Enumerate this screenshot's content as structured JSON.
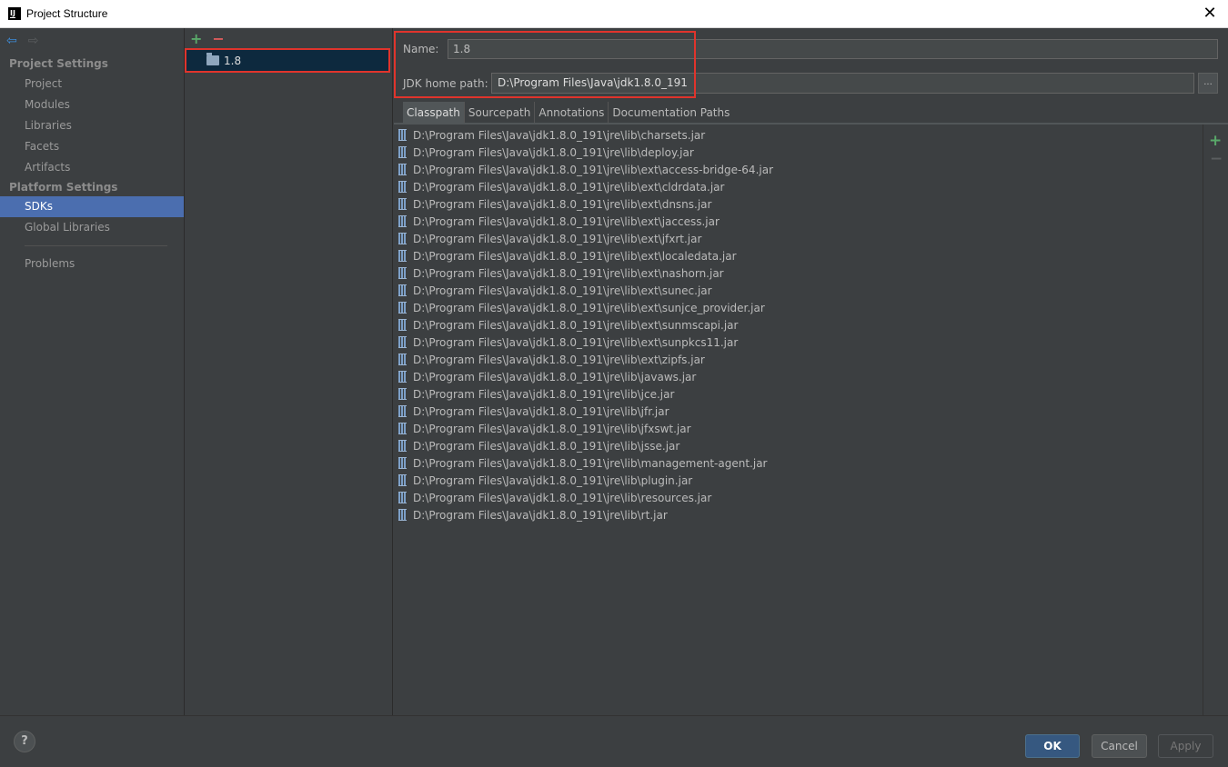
{
  "window": {
    "title": "Project Structure",
    "close_glyph": "✕",
    "logo_text": "IJ"
  },
  "nav": {
    "back_glyph": "⇦",
    "forward_glyph": "⇨",
    "project_settings_title": "Project Settings",
    "project_settings_items": [
      "Project",
      "Modules",
      "Libraries",
      "Facets",
      "Artifacts"
    ],
    "platform_settings_title": "Platform Settings",
    "platform_settings_items": [
      "SDKs",
      "Global Libraries"
    ],
    "active_item": "SDKs",
    "problems": "Problems"
  },
  "sdk_list": {
    "add_glyph": "+",
    "remove_glyph": "−",
    "items": [
      "1.8"
    ],
    "selected": "1.8"
  },
  "detail": {
    "name_label": "Name:",
    "name_value": "1.8",
    "jdk_label": "JDK home path:",
    "jdk_value": "D:\\Program Files\\Java\\jdk1.8.0_191",
    "browse_label": "...",
    "tabs": [
      "Classpath",
      "Sourcepath",
      "Annotations",
      "Documentation Paths"
    ],
    "active_tab": "Classpath",
    "add_glyph": "+",
    "remove_glyph": "−",
    "classpath": [
      "D:\\Program Files\\Java\\jdk1.8.0_191\\jre\\lib\\charsets.jar",
      "D:\\Program Files\\Java\\jdk1.8.0_191\\jre\\lib\\deploy.jar",
      "D:\\Program Files\\Java\\jdk1.8.0_191\\jre\\lib\\ext\\access-bridge-64.jar",
      "D:\\Program Files\\Java\\jdk1.8.0_191\\jre\\lib\\ext\\cldrdata.jar",
      "D:\\Program Files\\Java\\jdk1.8.0_191\\jre\\lib\\ext\\dnsns.jar",
      "D:\\Program Files\\Java\\jdk1.8.0_191\\jre\\lib\\ext\\jaccess.jar",
      "D:\\Program Files\\Java\\jdk1.8.0_191\\jre\\lib\\ext\\jfxrt.jar",
      "D:\\Program Files\\Java\\jdk1.8.0_191\\jre\\lib\\ext\\localedata.jar",
      "D:\\Program Files\\Java\\jdk1.8.0_191\\jre\\lib\\ext\\nashorn.jar",
      "D:\\Program Files\\Java\\jdk1.8.0_191\\jre\\lib\\ext\\sunec.jar",
      "D:\\Program Files\\Java\\jdk1.8.0_191\\jre\\lib\\ext\\sunjce_provider.jar",
      "D:\\Program Files\\Java\\jdk1.8.0_191\\jre\\lib\\ext\\sunmscapi.jar",
      "D:\\Program Files\\Java\\jdk1.8.0_191\\jre\\lib\\ext\\sunpkcs11.jar",
      "D:\\Program Files\\Java\\jdk1.8.0_191\\jre\\lib\\ext\\zipfs.jar",
      "D:\\Program Files\\Java\\jdk1.8.0_191\\jre\\lib\\javaws.jar",
      "D:\\Program Files\\Java\\jdk1.8.0_191\\jre\\lib\\jce.jar",
      "D:\\Program Files\\Java\\jdk1.8.0_191\\jre\\lib\\jfr.jar",
      "D:\\Program Files\\Java\\jdk1.8.0_191\\jre\\lib\\jfxswt.jar",
      "D:\\Program Files\\Java\\jdk1.8.0_191\\jre\\lib\\jsse.jar",
      "D:\\Program Files\\Java\\jdk1.8.0_191\\jre\\lib\\management-agent.jar",
      "D:\\Program Files\\Java\\jdk1.8.0_191\\jre\\lib\\plugin.jar",
      "D:\\Program Files\\Java\\jdk1.8.0_191\\jre\\lib\\resources.jar",
      "D:\\Program Files\\Java\\jdk1.8.0_191\\jre\\lib\\rt.jar"
    ]
  },
  "footer": {
    "help_glyph": "?",
    "ok_label": "OK",
    "cancel_label": "Cancel",
    "apply_label": "Apply"
  },
  "colors": {
    "background": "#3c3f41",
    "selection": "#4b6eaf",
    "highlight_box": "#e0342c",
    "ok_button": "#365880"
  }
}
